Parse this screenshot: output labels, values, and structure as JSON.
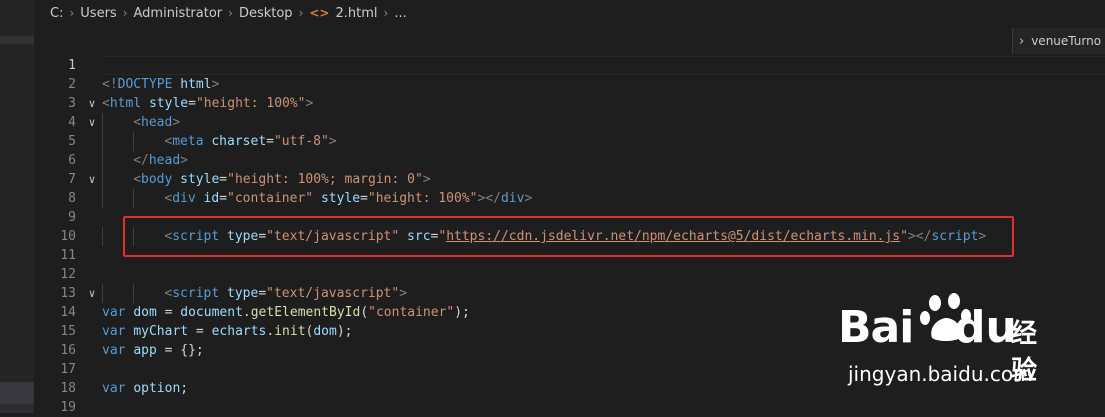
{
  "breadcrumb": {
    "segments": [
      "C:",
      "Users",
      "Administrator",
      "Desktop",
      "2.html",
      "..."
    ],
    "file_icon": "<>"
  },
  "outline": {
    "label": "venueTurno"
  },
  "editor": {
    "active_line": 1,
    "lines": [
      {
        "n": "1"
      },
      {
        "n": "2",
        "t": [
          "<!",
          "DOCTYPE",
          " ",
          "html",
          ">"
        ]
      },
      {
        "n": "3",
        "t": [
          "<",
          "html",
          " ",
          "style",
          "=",
          "\"height: 100%\"",
          ">"
        ]
      },
      {
        "n": "4",
        "t": [
          "<",
          "head",
          ">"
        ]
      },
      {
        "n": "5",
        "t": [
          "<",
          "meta",
          " ",
          "charset",
          "=",
          "\"utf-8\"",
          ">"
        ]
      },
      {
        "n": "6",
        "t": [
          "</",
          "head",
          ">"
        ]
      },
      {
        "n": "7",
        "t": [
          "<",
          "body",
          " ",
          "style",
          "=",
          "\"height: 100%; margin: 0\"",
          ">"
        ]
      },
      {
        "n": "8",
        "t": [
          "<",
          "div",
          " ",
          "id",
          "=",
          "\"container\"",
          " ",
          "style",
          "=",
          "\"height: 100%\"",
          "></",
          "div",
          ">"
        ]
      },
      {
        "n": "9"
      },
      {
        "n": "10",
        "t": [
          "<",
          "script",
          " ",
          "type",
          "=",
          "\"text/javascript\"",
          " ",
          "src",
          "=",
          "\"",
          "https://cdn.jsdelivr.net/npm/echarts@5/dist/echarts.min.js",
          "\"",
          "></",
          "script",
          ">"
        ]
      },
      {
        "n": "11"
      },
      {
        "n": "12"
      },
      {
        "n": "13",
        "t": [
          "<",
          "script",
          " ",
          "type",
          "=",
          "\"text/javascript\"",
          ">"
        ]
      },
      {
        "n": "14",
        "t": [
          "var",
          " ",
          "dom",
          " = ",
          "document",
          ".",
          "getElementById",
          "(",
          "\"container\"",
          ");"
        ]
      },
      {
        "n": "15",
        "t": [
          "var",
          " ",
          "myChart",
          " = ",
          "echarts",
          ".",
          "init",
          "(",
          "dom",
          ");"
        ]
      },
      {
        "n": "16",
        "t": [
          "var",
          " ",
          "app",
          " = {};"
        ]
      },
      {
        "n": "17"
      },
      {
        "n": "18",
        "t": [
          "var",
          " ",
          "option",
          ";"
        ]
      },
      {
        "n": "19"
      }
    ]
  },
  "watermark": {
    "bai": "Bai",
    "du": "du",
    "cn": "经验",
    "url": "jingyan.baidu.com"
  },
  "colors": {
    "background": "#1e1e1e",
    "highlight_box": "#e0322b",
    "tag": "#569cd6",
    "attribute": "#9cdcfe",
    "string": "#ce9178",
    "function": "#dcdcaa"
  }
}
